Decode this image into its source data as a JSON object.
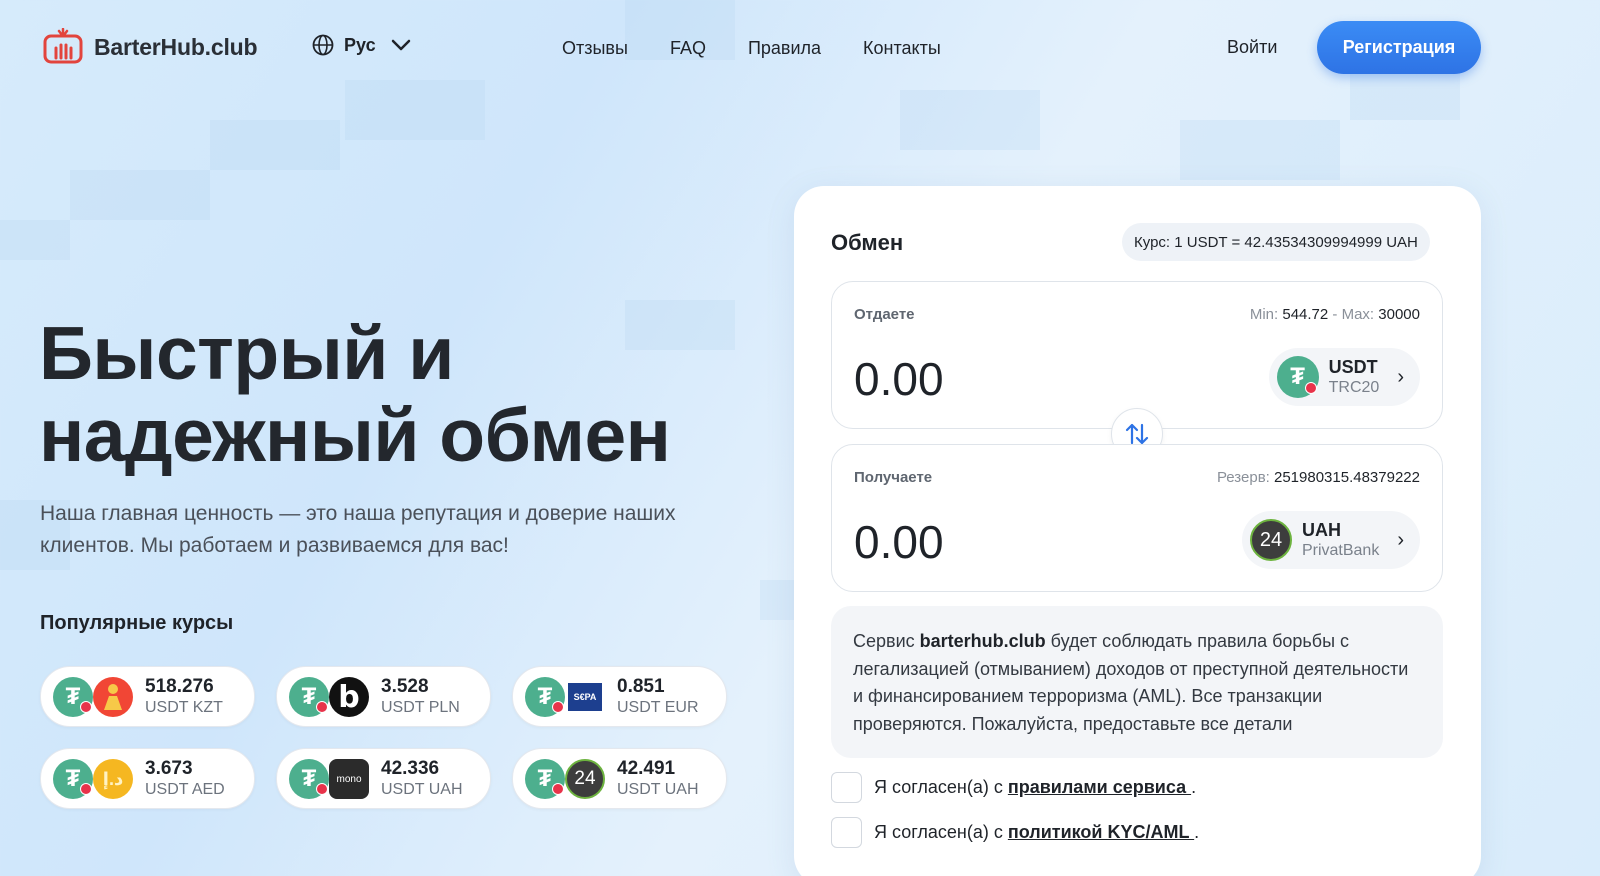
{
  "header": {
    "logo_text": "BarterHub.club",
    "language": "Рус",
    "nav": [
      "Отзывы",
      "FAQ",
      "Правила",
      "Контакты"
    ],
    "login": "Войти",
    "register": "Регистрация"
  },
  "hero": {
    "title_line1": "Быстрый и",
    "title_line2": "надежный обмен",
    "subtitle": "Наша главная ценность — это наша репутация и доверие наших клиентов. Мы работаем и развиваемся для вас!",
    "popular_title": "Популярные курсы"
  },
  "popular_rates": [
    {
      "value": "518.276",
      "pair": "USDT KZT",
      "icon": "kaspi-icon"
    },
    {
      "value": "3.528",
      "pair": "USDT PLN",
      "icon": "blik-icon"
    },
    {
      "value": "0.851",
      "pair": "USDT EUR",
      "icon": "sepa-icon"
    },
    {
      "value": "3.673",
      "pair": "USDT AED",
      "icon": "aed-coin-icon"
    },
    {
      "value": "42.336",
      "pair": "USDT UAH",
      "icon": "monobank-icon"
    },
    {
      "value": "42.491",
      "pair": "USDT UAH",
      "icon": "privatbank-icon"
    }
  ],
  "exchange": {
    "title": "Обмен",
    "rate": "Курс: 1 USDT = 42.43534309994999 UAH",
    "give": {
      "label": "Отдаете",
      "min_label": "Min:",
      "min_value": "544.72",
      "sep": "-",
      "max_label": "Max:",
      "max_value": "30000",
      "amount": "0.00",
      "currency_code": "USDT",
      "currency_network": "TRC20"
    },
    "get": {
      "label": "Получаете",
      "reserve_label": "Резерв:",
      "reserve_value": "251980315.48379222",
      "amount": "0.00",
      "currency_code": "UAH",
      "currency_network": "PrivatBank"
    },
    "aml_prefix": "Сервис ",
    "aml_brand": "barterhub.club",
    "aml_text": " будет соблюдать правила борьбы с легализацией (отмыванием) доходов от преступной деятельности и финансированием терроризма (AML). Все транзакции проверяются. Пожалуйста, предоставьте все детали",
    "agree1_prefix": "Я согласен(а) с ",
    "agree1_link": "правилами сервиса ",
    "agree2_prefix": "Я согласен(а) с ",
    "agree2_link": "политикой KYC/AML ",
    "agree_suffix": "."
  },
  "colors": {
    "accent": "#2e73e5",
    "tether": "#4daf8e",
    "privat": "#3d3d3d"
  }
}
